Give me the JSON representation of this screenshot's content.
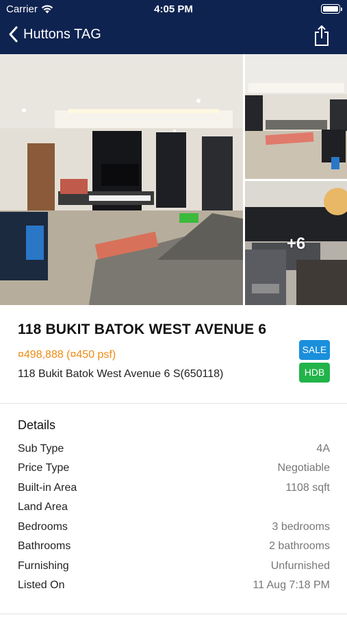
{
  "status_bar": {
    "carrier": "Carrier",
    "time": "4:05 PM"
  },
  "nav": {
    "back_title": "Huttons TAG"
  },
  "photos": {
    "more_label": "+6"
  },
  "listing": {
    "title": "118 BUKIT BATOK WEST AVENUE 6",
    "price": "¤498,888 (¤450 psf)",
    "address": "118 Bukit Batok West Avenue 6 S(650118)",
    "badges": {
      "sale": "SALE",
      "hdb": "HDB"
    }
  },
  "details": {
    "heading": "Details",
    "rows": [
      {
        "label": "Sub Type",
        "value": "4A"
      },
      {
        "label": "Price Type",
        "value": "Negotiable"
      },
      {
        "label": "Built-in Area",
        "value": "1108 sqft"
      },
      {
        "label": "Land Area",
        "value": ""
      },
      {
        "label": "Bedrooms",
        "value": "3 bedrooms"
      },
      {
        "label": "Bathrooms",
        "value": "2 bathrooms"
      },
      {
        "label": "Furnishing",
        "value": "Unfurnished"
      },
      {
        "label": "Listed On",
        "value": "11 Aug 7:18 PM"
      }
    ]
  },
  "colors": {
    "header": "#0e2350",
    "price": "#ef8a14",
    "sale_badge": "#1a8fdc",
    "hdb_badge": "#22b34a"
  }
}
